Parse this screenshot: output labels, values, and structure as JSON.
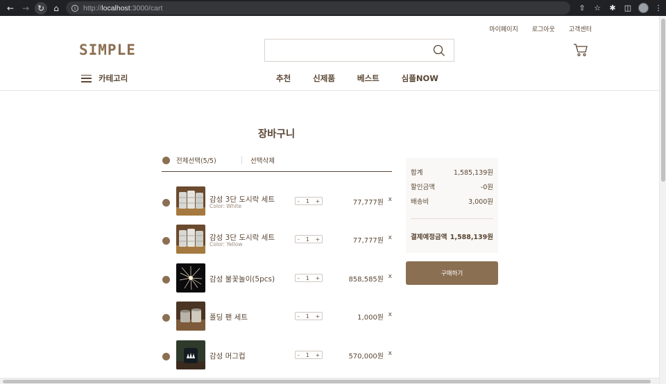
{
  "browser": {
    "url_prefix": "http://",
    "url_host": "localhost",
    "url_rest": ":3000/cart"
  },
  "util_links": [
    "마이페이지",
    "로그아웃",
    "고객센터"
  ],
  "logo": "SIMPLE",
  "search": {
    "placeholder": ""
  },
  "category_label": "카테고리",
  "menu": [
    "추천",
    "신제품",
    "베스트",
    "심플NOW"
  ],
  "cart": {
    "title": "장바구니",
    "select_all": "전체선택(5/5)",
    "delete_selected": "선택삭제",
    "items": [
      {
        "name": "감성 3단 도시락 세트",
        "color": "Color: White",
        "qty": "1",
        "price": "77,777원"
      },
      {
        "name": "감성 3단 도시락 세트",
        "color": "Color: Yellow",
        "qty": "1",
        "price": "77,777원"
      },
      {
        "name": "감성 불꽃놀이(5pcs)",
        "color": "",
        "qty": "1",
        "price": "858,585원"
      },
      {
        "name": "폴딩 팬 세트",
        "color": "",
        "qty": "1",
        "price": "1,000원"
      },
      {
        "name": "감성 머그컵",
        "color": "",
        "qty": "1",
        "price": "570,000원"
      }
    ],
    "minus": "-",
    "plus": "+",
    "remove": "x"
  },
  "summary": {
    "subtotal_label": "합계",
    "subtotal": "1,585,139원",
    "discount_label": "할인금액",
    "discount": "-0원",
    "shipping_label": "배송비",
    "shipping": "3,000원",
    "total_label": "결제예정금액",
    "total": "1,588,139원",
    "buy_label": "구매하기"
  },
  "colors": {
    "brand": "#8b6f52",
    "text": "#5a4634",
    "chrome": "#202124"
  }
}
